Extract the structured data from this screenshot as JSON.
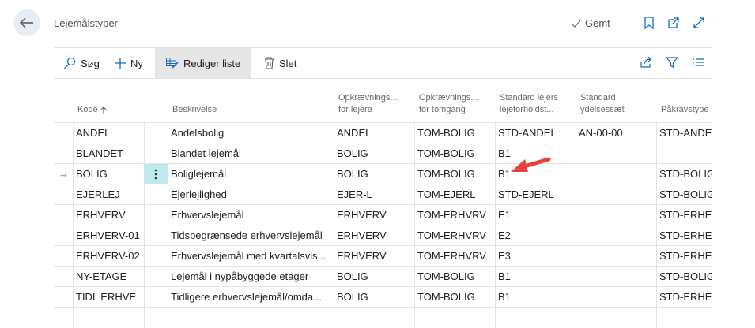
{
  "header": {
    "title": "Lejemålstyper",
    "saved_label": "Gemt"
  },
  "toolbar": {
    "search_label": "Søg",
    "new_label": "Ny",
    "edit_list_label": "Rediger liste",
    "delete_label": "Slet"
  },
  "columns": {
    "kode": "Kode",
    "beskrivelse": "Beskrivelse",
    "opk_lejere_1": "Opkrævnings...",
    "opk_lejere_2": "for lejere",
    "opk_tomgang_1": "Opkrævnings...",
    "opk_tomgang_2": "for tomgang",
    "std_lejers_1": "Standard lejers",
    "std_lejers_2": "lejeforholdst...",
    "std_ydelse_1": "Standard",
    "std_ydelse_2": "ydelsessæt",
    "paakrav": "Påkravstype"
  },
  "rows": [
    {
      "kode": "ANDEL",
      "beskrivelse": "Andelsbolig",
      "lejere": "ANDEL",
      "tomgang": "TOM-BOLIG",
      "lejers": "STD-ANDEL",
      "ydelse": "AN-00-00",
      "paakrav": "STD-ANDE"
    },
    {
      "kode": "BLANDET",
      "beskrivelse": "Blandet lejemål",
      "lejere": "BOLIG",
      "tomgang": "TOM-BOLIG",
      "lejers": "B1",
      "ydelse": "",
      "paakrav": ""
    },
    {
      "kode": "BOLIG",
      "beskrivelse": "Boliglejemål",
      "lejere": "BOLIG",
      "tomgang": "TOM-BOLIG",
      "lejers": "B1",
      "ydelse": "",
      "paakrav": "STD-BOLIG"
    },
    {
      "kode": "EJERLEJ",
      "beskrivelse": "Ejerlejlighed",
      "lejere": "EJER-L",
      "tomgang": "TOM-EJERL",
      "lejers": "STD-EJERL",
      "ydelse": "",
      "paakrav": "STD-BOLIG"
    },
    {
      "kode": "ERHVERV",
      "beskrivelse": "Erhvervslejemål",
      "lejere": "ERHVERV",
      "tomgang": "TOM-ERHVRV",
      "lejers": "E1",
      "ydelse": "",
      "paakrav": "STD-ERHEF"
    },
    {
      "kode": "ERHVERV-01",
      "beskrivelse": "Tidsbegrænsede erhvervslejemål",
      "lejere": "ERHVERV",
      "tomgang": "TOM-ERHVRV",
      "lejers": "E2",
      "ydelse": "",
      "paakrav": "STD-ERHEF"
    },
    {
      "kode": "ERHVERV-02",
      "beskrivelse": "Erhvervslejemål med kvartalsvis...",
      "lejere": "ERHVERV",
      "tomgang": "TOM-ERHVRV",
      "lejers": "E3",
      "ydelse": "",
      "paakrav": "STD-ERHEF"
    },
    {
      "kode": "NY-ETAGE",
      "beskrivelse": "Lejemål i nypåbyggede etager",
      "lejere": "BOLIG",
      "tomgang": "TOM-BOLIG",
      "lejers": "B1",
      "ydelse": "",
      "paakrav": "STD-BOLIG"
    },
    {
      "kode": "TIDL ERHVE",
      "beskrivelse": "Tidligere erhvervslejemål/omda...",
      "lejere": "BOLIG",
      "tomgang": "TOM-BOLIG",
      "lejers": "B1",
      "ydelse": "",
      "paakrav": "STD-ERHEF"
    }
  ],
  "colors": {
    "accent": "#0f6cbd",
    "selected": "#bfe9ec",
    "annotation": "#e8413b"
  }
}
